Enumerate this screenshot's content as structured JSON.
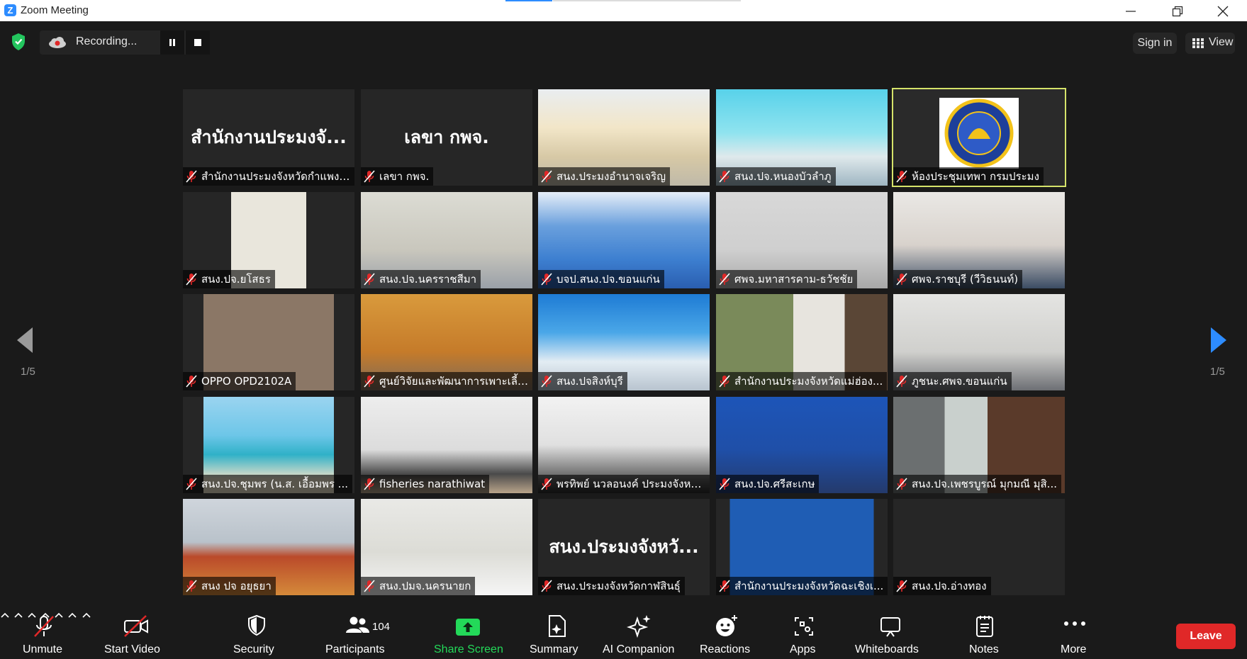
{
  "window": {
    "title": "Zoom Meeting"
  },
  "topbar": {
    "recording_label": "Recording...",
    "sign_in_label": "Sign in",
    "view_label": "View"
  },
  "pagination": {
    "left_label": "1/5",
    "right_label": "1/5"
  },
  "tiles": [
    {
      "name": "สำนักงานประมงจังหวัดกำแพงเ...",
      "big": "สำนักงานประมงจั...",
      "scene": "blank"
    },
    {
      "name": "เลขา กพจ.",
      "big": "เลขา กพจ.",
      "scene": "blank"
    },
    {
      "name": "สนง.ประมงอำนาจเจริญ",
      "big": "",
      "scene": "map"
    },
    {
      "name": "สนง.ปจ.หนองบัวลำภู",
      "big": "",
      "scene": "meetingroom"
    },
    {
      "name": "ห้องประชุมเทพา กรมประมง",
      "big": "",
      "scene": "logo",
      "active": true
    },
    {
      "name": "สนง.ปจ.ยโสธร",
      "big": "",
      "scene": "door"
    },
    {
      "name": "สนง.ปจ.นครราชสีมา",
      "big": "",
      "scene": "person-light"
    },
    {
      "name": "บจป.สนง.ปจ.ขอนแก่น",
      "big": "",
      "scene": "building"
    },
    {
      "name": "ศพจ.มหาสารคาม-ธวัชชัย",
      "big": "",
      "scene": "person-grey"
    },
    {
      "name": "ศพจ.ราชบุรี (วีวิธนนท์)",
      "big": "",
      "scene": "person-close"
    },
    {
      "name": "OPPO OPD2102A",
      "big": "",
      "scene": "ceiling"
    },
    {
      "name": "ศูนย์วิจัยและพัฒนาการเพาะเลี้ยงสั...",
      "big": "",
      "scene": "wood"
    },
    {
      "name": "สนง.ปจสิงห์บุรี",
      "big": "",
      "scene": "office-blue"
    },
    {
      "name": "สำนักงานประมงจังหวัดแม่ฮ่อง...",
      "big": "",
      "scene": "office-shelf"
    },
    {
      "name": "ภูชนะ.ศพจ.ขอนแก่น",
      "big": "",
      "scene": "grid-wall"
    },
    {
      "name": "สนง.ปจ.ชุมพร (น.ส. เอื้อมพร ...",
      "big": "",
      "scene": "beach"
    },
    {
      "name": "fisheries narathiwat",
      "big": "",
      "scene": "room-table"
    },
    {
      "name": "พรทิพย์ นวลอนงค์ ประมงจังหว...",
      "big": "",
      "scene": "person-mic"
    },
    {
      "name": "สนง.ปจ.ศรีสะเกษ",
      "big": "",
      "scene": "banner-blue"
    },
    {
      "name": "สนง.ปจ.เพชรบูรณ์ มุกมณี มุสิ...",
      "big": "",
      "scene": "trees"
    },
    {
      "name": "สนง ปจ อยุธยา",
      "big": "",
      "scene": "wall-red"
    },
    {
      "name": "สนง.ปมจ.นครนายก",
      "big": "",
      "scene": "person-uniform"
    },
    {
      "name": "สนง.ประมงจังหวัดกาฬสินธุ์",
      "big": "สนง.ประมงจังหวั...",
      "scene": "blank"
    },
    {
      "name": "สำนักงานประมงจังหวัดฉะเชิงเ...",
      "big": "",
      "scene": "sign-blue"
    },
    {
      "name": "สนง.ปจ.อ่างทอง",
      "big": "",
      "scene": "blank"
    }
  ],
  "toolbar": {
    "unmute": "Unmute",
    "start_video": "Start Video",
    "security": "Security",
    "participants": "Participants",
    "participants_count": "104",
    "share_screen": "Share Screen",
    "summary": "Summary",
    "ai_companion": "AI Companion",
    "reactions": "Reactions",
    "apps": "Apps",
    "whiteboards": "Whiteboards",
    "notes": "Notes",
    "more": "More",
    "leave": "Leave"
  },
  "colors": {
    "background": "#1a1a1a",
    "tile": "#262626",
    "active_speaker": "#d5e36a",
    "share_green": "#23d959",
    "leave_red": "#e02828",
    "mute_red": "#e02828"
  }
}
